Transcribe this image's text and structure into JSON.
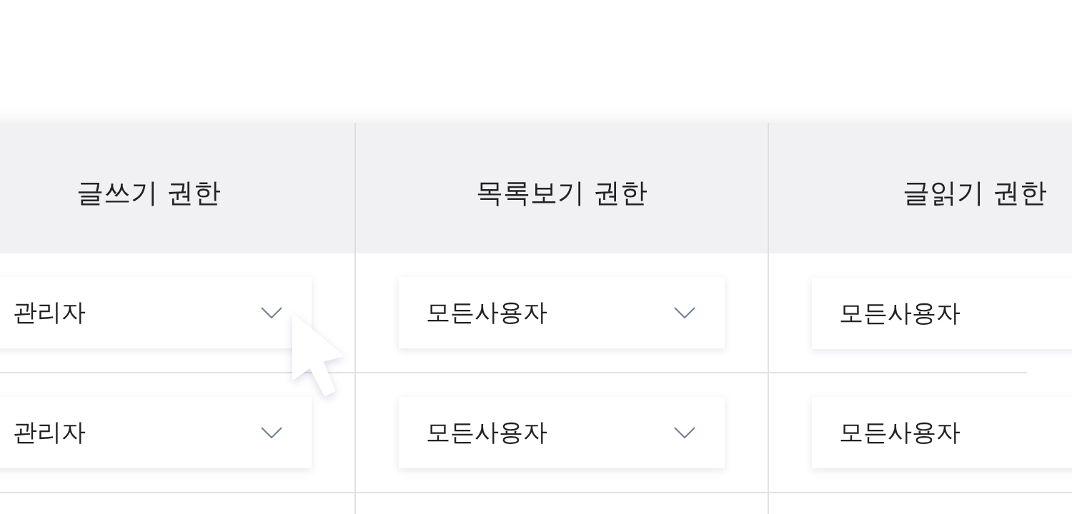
{
  "table": {
    "columns": [
      {
        "label": "글쓰기 권한"
      },
      {
        "label": "목록보기 권한"
      },
      {
        "label": "글읽기 권한"
      }
    ],
    "rows": [
      {
        "cells": [
          {
            "value": "관리자"
          },
          {
            "value": "모든사용자"
          },
          {
            "value": "모든사용자"
          }
        ]
      },
      {
        "cells": [
          {
            "value": "관리자"
          },
          {
            "value": "모든사용자"
          },
          {
            "value": "모든사용자"
          }
        ]
      }
    ]
  }
}
